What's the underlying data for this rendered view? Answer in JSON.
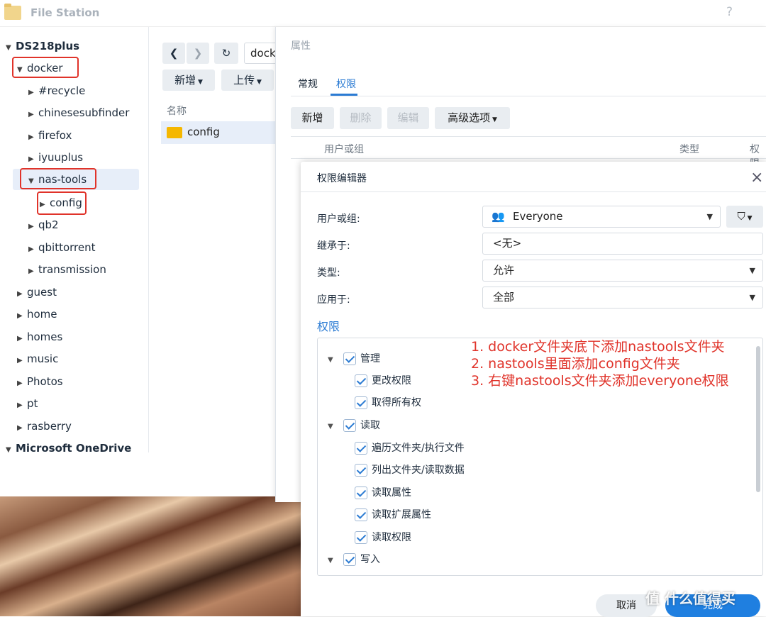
{
  "titlebar": {
    "app_title": "File Station",
    "help": "?",
    "minimize": "–"
  },
  "sidebar": {
    "root": "DS218plus",
    "items": [
      {
        "label": "docker",
        "expanded": true
      },
      {
        "label": "#recycle"
      },
      {
        "label": "chinesesubfinder"
      },
      {
        "label": "firefox"
      },
      {
        "label": "iyuuplus"
      },
      {
        "label": "nas-tools",
        "expanded": true,
        "selected": true
      },
      {
        "label": "config"
      },
      {
        "label": "qb2"
      },
      {
        "label": "qbittorrent"
      },
      {
        "label": "transmission"
      },
      {
        "label": "guest"
      },
      {
        "label": "home"
      },
      {
        "label": "homes"
      },
      {
        "label": "music"
      },
      {
        "label": "Photos"
      },
      {
        "label": "pt"
      },
      {
        "label": "rasberry"
      }
    ],
    "second_root": "Microsoft OneDrive"
  },
  "main": {
    "path": "dock",
    "new_label": "新增",
    "upload_label": "上传",
    "col_name": "名称",
    "files": [
      {
        "name": "config"
      }
    ]
  },
  "properties": {
    "title": "属性",
    "tabs": [
      "常规",
      "权限"
    ],
    "active_tab": "权限",
    "buttons": {
      "add": "新增",
      "delete": "删除",
      "edit": "编辑",
      "advanced": "高级选项"
    },
    "columns": {
      "user": "用户或组",
      "type": "类型",
      "perm": "权限"
    }
  },
  "editor": {
    "title": "权限编辑器",
    "fields": {
      "user_label": "用户或组:",
      "user_value": "Everyone",
      "inherit_label": "继承于:",
      "inherit_value": "<无>",
      "type_label": "类型:",
      "type_value": "允许",
      "apply_label": "应用于:",
      "apply_value": "全部"
    },
    "section": "权限",
    "groups": [
      {
        "label": "管理",
        "items": [
          "更改权限",
          "取得所有权"
        ]
      },
      {
        "label": "读取",
        "items": [
          "遍历文件夹/执行文件",
          "列出文件夹/读取数据",
          "读取属性",
          "读取扩展属性",
          "读取权限"
        ]
      },
      {
        "label": "写入",
        "items": []
      }
    ],
    "cancel_label": "取消",
    "ok_label": "完成"
  },
  "annotations": [
    "1. docker文件夹底下添加nastools文件夹",
    "2. nastools里面添加config文件夹",
    "3. 右键nastools文件夹添加everyone权限"
  ],
  "watermark": "值 什么值得买",
  "colors": {
    "accent": "#2b7bd3",
    "annotation_red": "#e0332a",
    "primary_button": "#1f7fe0"
  }
}
